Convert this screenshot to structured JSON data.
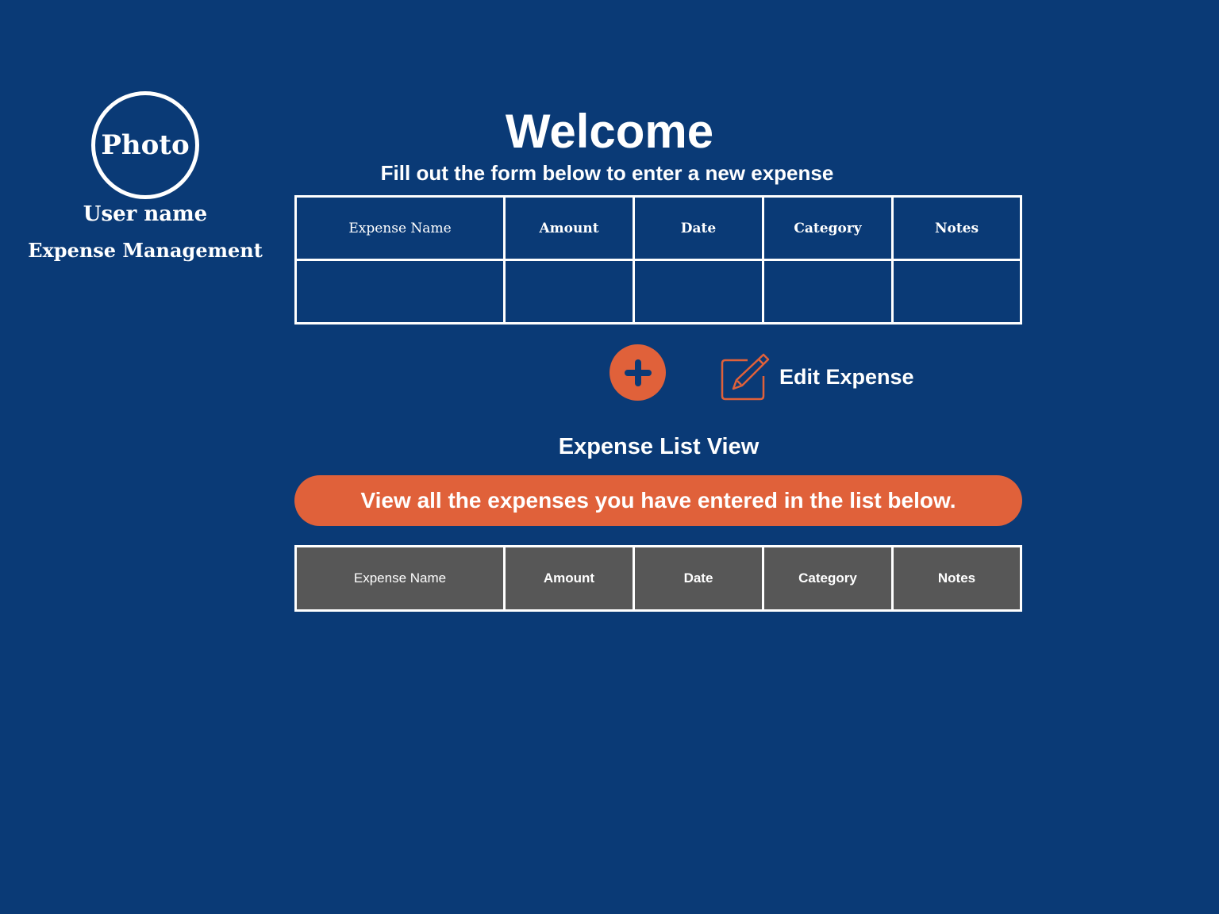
{
  "sidebar": {
    "photo_label": "Photo",
    "user_name": "User name",
    "app_name": "Expense Management"
  },
  "header": {
    "title": "Welcome",
    "subtitle": "Fill out the form below to enter a new expense"
  },
  "form_table": {
    "columns": [
      "Expense Name",
      "Amount",
      "Date",
      "Category",
      "Notes"
    ],
    "row": [
      "",
      "",
      "",
      "",
      ""
    ]
  },
  "actions": {
    "add_icon": "plus-icon",
    "edit_icon": "pencil-square-icon",
    "edit_label": "Edit Expense"
  },
  "list_view": {
    "title": "Expense List View",
    "banner": "View all the expenses you have entered in the list below.",
    "columns": [
      "Expense Name",
      "Amount",
      "Date",
      "Category",
      "Notes"
    ]
  },
  "colors": {
    "background": "#0a3a76",
    "accent": "#e0613a",
    "list_header": "#575757",
    "text": "#ffffff"
  }
}
